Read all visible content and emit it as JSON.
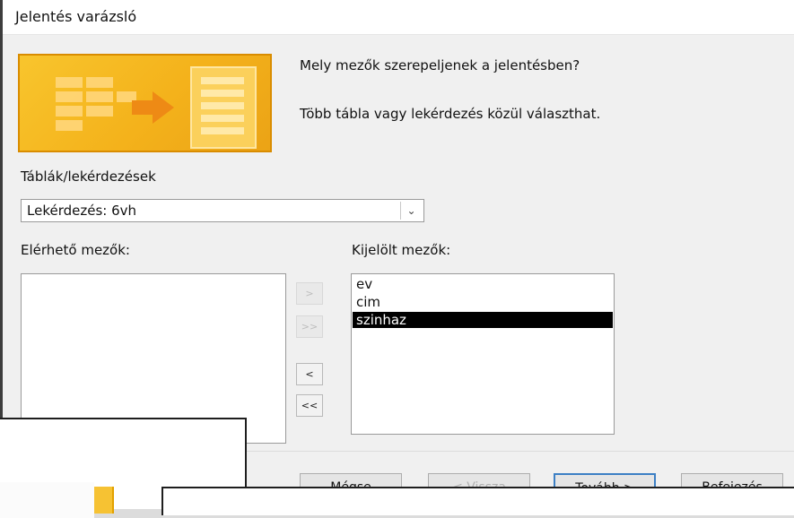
{
  "window": {
    "title": "Jelentés varázsló"
  },
  "intro": {
    "question": "Mely mezők szerepeljenek a jelentésben?",
    "hint": "Több tábla vagy lekérdezés közül választhat."
  },
  "tables": {
    "label": "Táblák/lekérdezések",
    "selected": "Lekérdezés: 6vh",
    "dropdown_icon": "chevron-down-icon"
  },
  "available": {
    "label": "Elérhető mezők:",
    "items": []
  },
  "selected_fields": {
    "label": "Kijelölt mezők:",
    "items": [
      "ev",
      "cim",
      "szinhaz"
    ],
    "selected_index": 2
  },
  "move_buttons": {
    "add_one": ">",
    "add_all": ">>",
    "remove_one": "<",
    "remove_all": "<<"
  },
  "footer": {
    "cancel": "Mégse",
    "back": "< Vissza",
    "next": "Tovább >",
    "finish": "Befejezés"
  },
  "colors": {
    "banner": "#f4b21b",
    "selection": "#000000",
    "default_button_border": "#3c7fc4"
  }
}
